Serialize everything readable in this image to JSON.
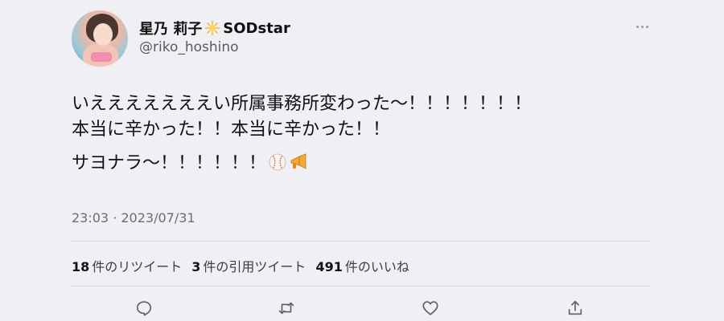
{
  "user": {
    "display_name": "星乃 莉子",
    "affiliation": "SODstar",
    "handle": "@riko_hoshino"
  },
  "tweet": {
    "lines": [
      "いえええええええい所属事務所変わった〜！！！！！！！",
      "本当に辛かった！！本当に辛かった！！",
      "サヨナラ〜！！！！！！"
    ],
    "emojis": [
      "baseball",
      "megaphone"
    ],
    "timestamp": "23:03 · 2023/07/31"
  },
  "stats": {
    "retweets": {
      "count": "18",
      "label": "件のリツイート"
    },
    "quotes": {
      "count": "3",
      "label": "件の引用ツイート"
    },
    "likes": {
      "count": "491",
      "label": "件のいいね"
    }
  },
  "icons": [
    "more-icon",
    "sparkle-icon",
    "reply-icon",
    "retweet-icon",
    "like-icon",
    "share-icon"
  ],
  "colors": {
    "background": "#efeff4",
    "text": "#111111",
    "secondary_text": "#5b5b5f",
    "icon": "#5f5f64"
  }
}
